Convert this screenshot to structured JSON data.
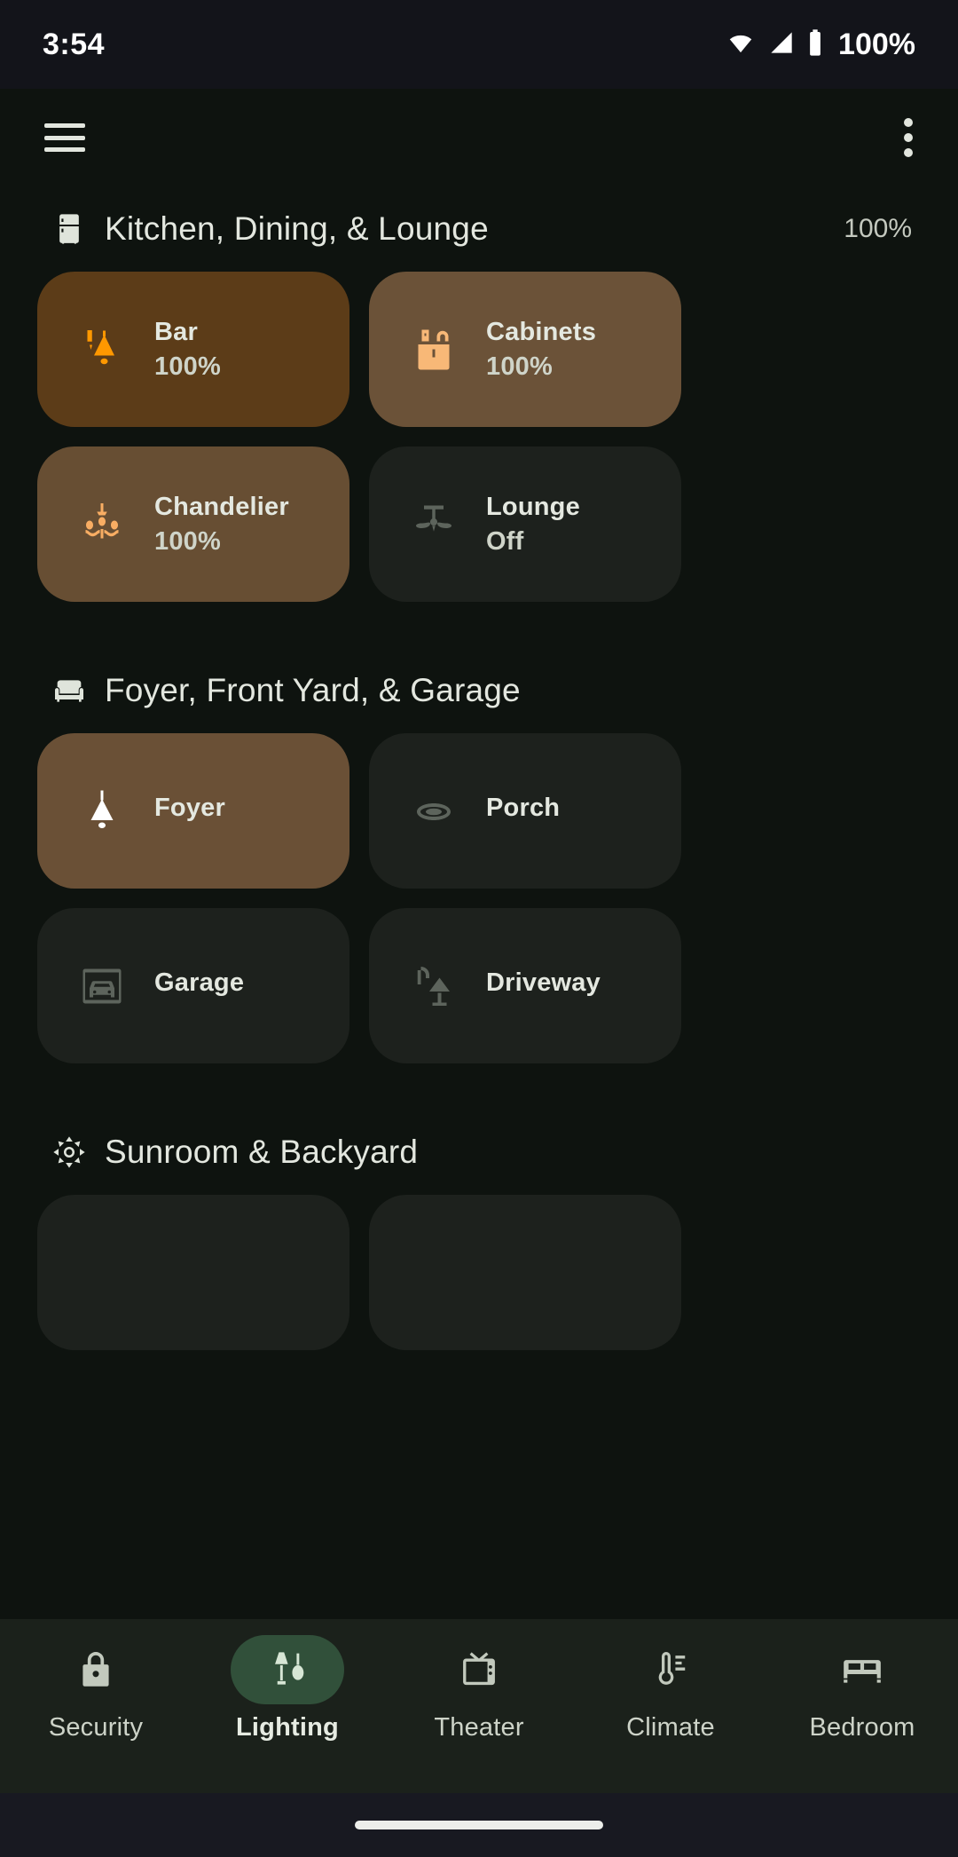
{
  "status_bar": {
    "time": "3:54",
    "battery_percent": "100%",
    "icons": [
      "wifi-icon",
      "cellular-signal-icon",
      "battery-icon"
    ]
  },
  "app_bar": {
    "menu_icon": "hamburger-menu-icon",
    "overflow_icon": "overflow-menu-icon"
  },
  "sections": [
    {
      "title": "Kitchen, Dining, & Lounge",
      "icon": "refrigerator-icon",
      "percent": "100%",
      "tiles": [
        {
          "name": "Bar",
          "state": "100%",
          "icon": "wall-sconce-icon",
          "on": true,
          "bg": "#5c3c18",
          "icon_color": "#ff9800"
        },
        {
          "name": "Cabinets",
          "state": "100%",
          "icon": "cabinet-icon",
          "on": true,
          "bg": "#6b5238",
          "icon_color": "#f8b877"
        },
        {
          "name": "Chandelier",
          "state": "100%",
          "icon": "chandelier-icon",
          "on": true,
          "bg": "#674e33",
          "icon_color": "#f8ad63"
        },
        {
          "name": "Lounge",
          "state": "Off",
          "icon": "ceiling-fan-icon",
          "on": false,
          "bg": "#1d211d",
          "icon_color": "#5d645c"
        }
      ]
    },
    {
      "title": "Foyer, Front Yard, & Garage",
      "icon": "sofa-icon",
      "percent": "",
      "tiles": [
        {
          "name": "Foyer",
          "state": "",
          "icon": "pendant-light-icon",
          "on": true,
          "bg": "#6a5036",
          "icon_color": "#ffffff"
        },
        {
          "name": "Porch",
          "state": "",
          "icon": "ceiling-light-icon",
          "on": false,
          "bg": "#1d211d",
          "icon_color": "#5d645c"
        },
        {
          "name": "Garage",
          "state": "",
          "icon": "garage-door-icon",
          "on": false,
          "bg": "#1d211d",
          "icon_color": "#5d645c"
        },
        {
          "name": "Driveway",
          "state": "",
          "icon": "outdoor-lamp-icon",
          "on": false,
          "bg": "#1d211d",
          "icon_color": "#5d645c"
        }
      ]
    },
    {
      "title": "Sunroom & Backyard",
      "icon": "brightness-sun-icon",
      "percent": "",
      "tiles": [
        {
          "name": "",
          "state": "",
          "icon": "",
          "on": false,
          "bg": "#1d211d",
          "icon_color": "#5d645c"
        },
        {
          "name": "",
          "state": "",
          "icon": "",
          "on": false,
          "bg": "#1d211d",
          "icon_color": "#5d645c"
        }
      ]
    }
  ],
  "bottom_nav": {
    "items": [
      {
        "label": "Security",
        "icon": "lock-icon",
        "active": false
      },
      {
        "label": "Lighting",
        "icon": "lamps-icon",
        "active": true
      },
      {
        "label": "Theater",
        "icon": "tv-icon",
        "active": false
      },
      {
        "label": "Climate",
        "icon": "thermometer-icon",
        "active": false
      },
      {
        "label": "Bedroom",
        "icon": "bed-icon",
        "active": false
      }
    ]
  },
  "colors": {
    "background": "#0e130f",
    "status_bar_bg": "#13141a",
    "nav_bg": "#1b211b",
    "accent_active": "#31503a",
    "tile_off_bg": "#1d211d",
    "text_primary": "#e4e8e0"
  }
}
